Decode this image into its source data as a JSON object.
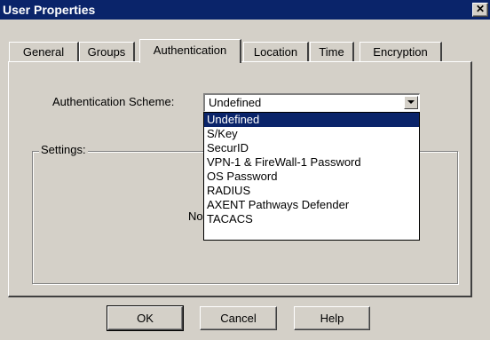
{
  "window": {
    "title": "User Properties",
    "close_glyph": "✕"
  },
  "tabs": [
    {
      "label": "General"
    },
    {
      "label": "Groups"
    },
    {
      "label": "Authentication"
    },
    {
      "label": "Location"
    },
    {
      "label": "Time"
    },
    {
      "label": "Encryption"
    }
  ],
  "active_tab": "Authentication",
  "auth": {
    "scheme_label": "Authentication Scheme:",
    "scheme_value": "Undefined",
    "options": [
      "Undefined",
      "S/Key",
      "SecurID",
      "VPN-1 & FireWall-1 Password",
      "OS Password",
      "RADIUS",
      "AXENT Pathways Defender",
      "TACACS"
    ],
    "selected_option": "Undefined"
  },
  "settings": {
    "group_label": "Settings:",
    "partial_text": "No"
  },
  "buttons": {
    "ok": "OK",
    "cancel": "Cancel",
    "help": "Help"
  },
  "colors": {
    "titlebar": "#0a246a",
    "face": "#d4d0c8",
    "selection": "#0a246a"
  }
}
